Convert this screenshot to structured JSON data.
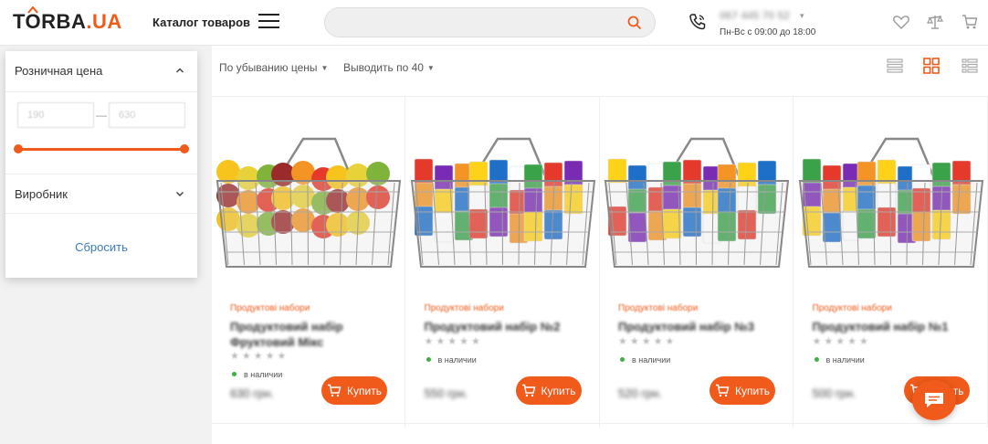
{
  "header": {
    "logo": {
      "prefix": "T",
      "o": "O",
      "rest": "RBA",
      "tld": ".UA"
    },
    "catalog_label": "Каталог товаров",
    "search": {
      "placeholder": ""
    },
    "phone": "067 445 70 52",
    "hours": "Пн-Вс с 09:00 до 18:00"
  },
  "filter": {
    "price_title": "Розничная цена",
    "price_min": "190",
    "price_max": "630",
    "range_fraction": [
      0,
      1
    ],
    "manufacturer_title": "Виробник",
    "reset_label": "Сбросить"
  },
  "toolbar": {
    "sort_label": "По убыванию цены",
    "perpage_label": "Выводить по 40"
  },
  "products": [
    {
      "category": "Продуктові набори",
      "title": "Продуктовий набір Фруктовий Мікс",
      "stars": "★★★★★",
      "availability": "в наличии",
      "price": "630 грн.",
      "buy_label": "Купить"
    },
    {
      "category": "Продуктові набори",
      "title": "Продуктовий набір №2",
      "stars": "★★★★★",
      "availability": "в наличии",
      "price": "550 грн.",
      "buy_label": "Купить"
    },
    {
      "category": "Продуктові набори",
      "title": "Продуктовий набір №3",
      "stars": "★★★★★",
      "availability": "в наличии",
      "price": "520 грн.",
      "buy_label": "Купить"
    },
    {
      "category": "Продуктові набори",
      "title": "Продуктовий набір №1",
      "stars": "★★★★★",
      "availability": "в наличии",
      "price": "500 грн.",
      "buy_label": "Купить"
    }
  ],
  "colors": {
    "accent": "#f05a1a",
    "link": "#3b7bbf",
    "in_stock": "#3cb043"
  },
  "icons": [
    "search-icon",
    "phone-icon",
    "heart-icon",
    "compare-scales-icon",
    "cart-icon",
    "list-view-icon",
    "grid-view-icon",
    "detailed-list-view-icon",
    "chat-icon"
  ]
}
